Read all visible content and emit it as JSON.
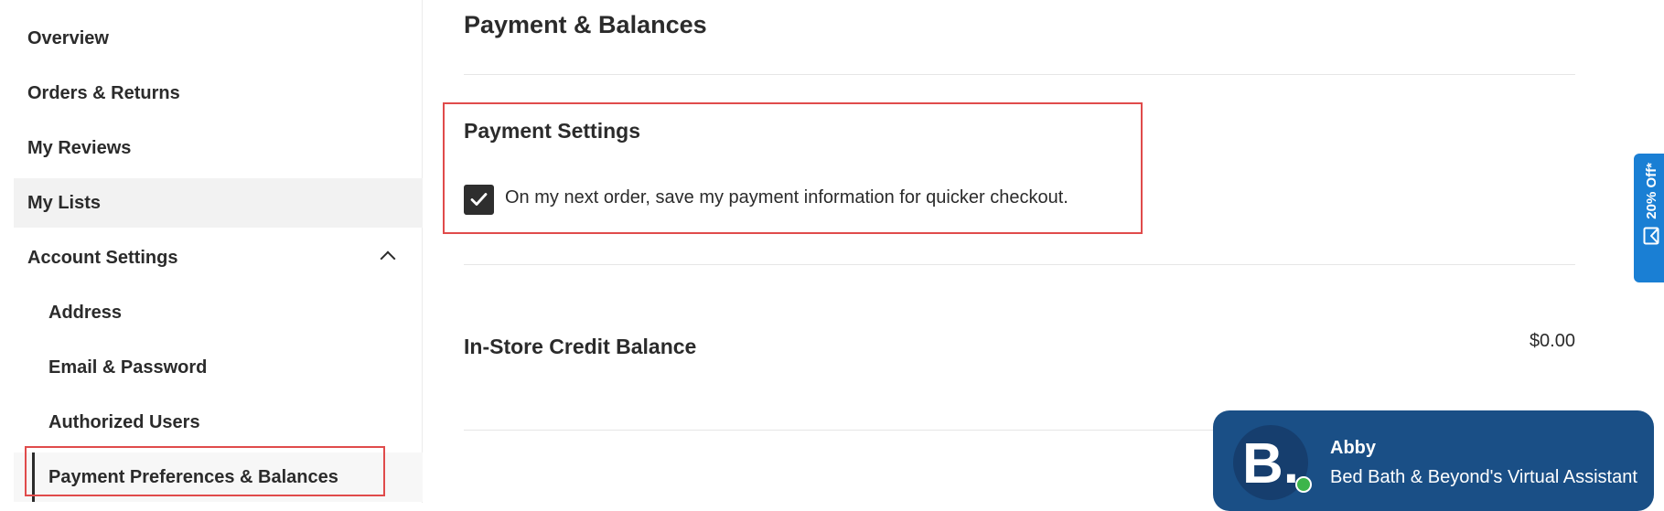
{
  "sidebar": {
    "items": [
      {
        "label": "Overview"
      },
      {
        "label": "Orders & Returns"
      },
      {
        "label": "My Reviews"
      },
      {
        "label": "My Lists"
      },
      {
        "label": "Account Settings"
      }
    ],
    "sub_items": [
      {
        "label": "Address"
      },
      {
        "label": "Email & Password"
      },
      {
        "label": "Authorized Users"
      },
      {
        "label": "Payment Preferences & Balances"
      }
    ]
  },
  "main": {
    "title": "Payment & Balances",
    "payment_settings": {
      "title": "Payment Settings",
      "save_payment_label": "On my next order, save my payment information for quicker checkout.",
      "checked": true
    },
    "credit": {
      "title": "In-Store Credit Balance",
      "amount": "$0.00"
    }
  },
  "promo": {
    "label": "20% Off*"
  },
  "chat": {
    "avatar_letter": "B.",
    "name": "Abby",
    "subtitle": "Bed Bath & Beyond's Virtual Assistant"
  },
  "colors": {
    "highlight": "#e04b4b",
    "promo_blue": "#1a7fd4",
    "chat_blue": "#1a4f86",
    "online_green": "#3db54a"
  }
}
